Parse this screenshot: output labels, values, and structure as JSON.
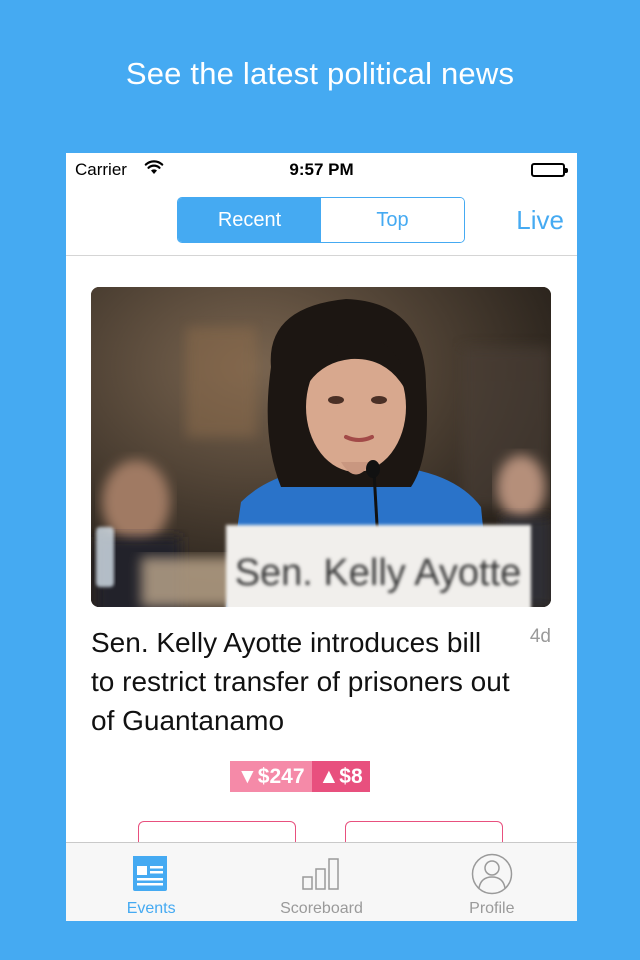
{
  "promo": {
    "headline": "See the latest political news"
  },
  "status_bar": {
    "carrier": "Carrier",
    "time": "9:57 PM"
  },
  "nav": {
    "segments": [
      "Recent",
      "Top"
    ],
    "selected": "Recent",
    "live_label": "Live"
  },
  "article": {
    "title": "Sen. Kelly Ayotte introduces bill to restrict transfer of prisoners out of Guantanamo",
    "age": "4d",
    "image_placard": "Sen. Kelly Ayotte",
    "price_down": "▼$247",
    "price_up": "▲$8"
  },
  "tabbar": {
    "items": [
      {
        "label": "Events",
        "icon": "events-icon",
        "active": true
      },
      {
        "label": "Scoreboard",
        "icon": "scoreboard-icon",
        "active": false
      },
      {
        "label": "Profile",
        "icon": "profile-icon",
        "active": false
      }
    ]
  },
  "colors": {
    "accent": "#45aaf2",
    "price_down": "#f58aa8",
    "price_up": "#e8507e"
  }
}
